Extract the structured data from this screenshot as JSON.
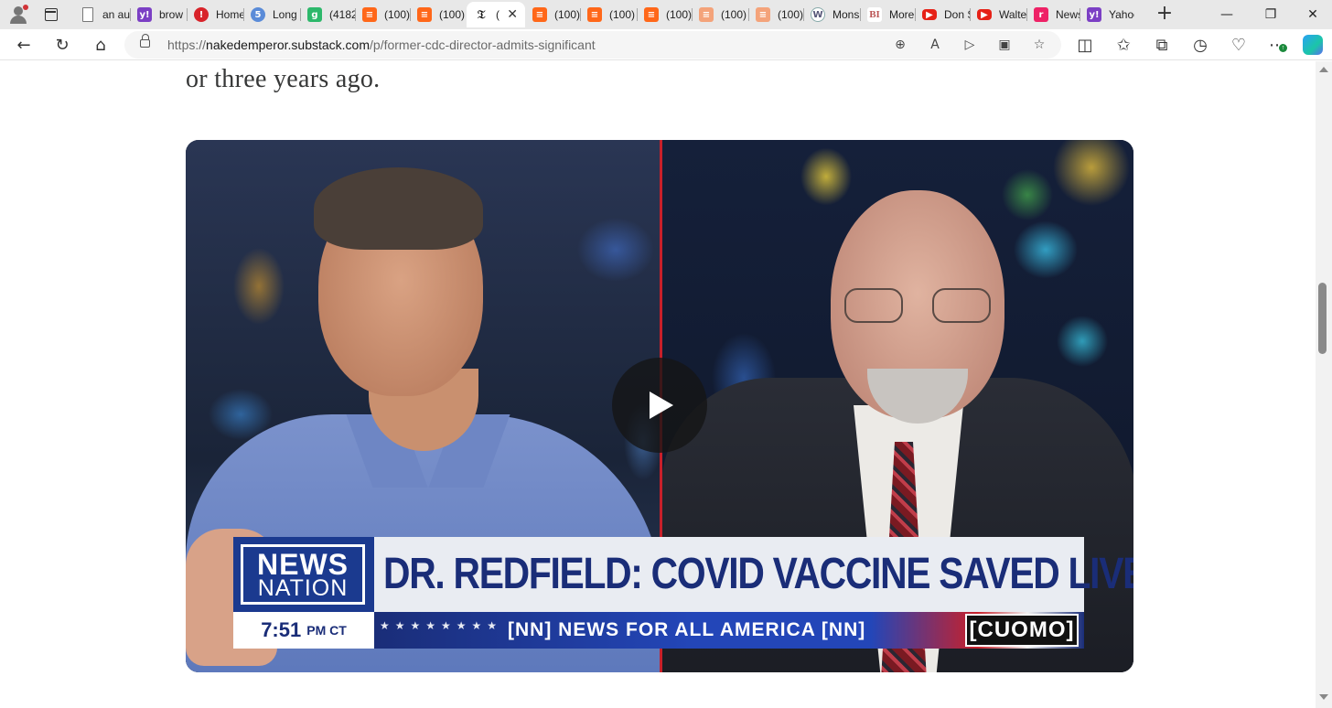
{
  "browser": {
    "tabs": [
      {
        "label": "an au",
        "favicon": "document-icon",
        "fav_glyph": "",
        "fav_class": "doc",
        "width": 62
      },
      {
        "label": "brow",
        "favicon": "yahoo-icon",
        "fav_glyph": "y!",
        "fav_class": "yahoo",
        "width": 62
      },
      {
        "label": "Home",
        "favicon": "red-pin-icon",
        "fav_glyph": "!",
        "fav_class": "red",
        "width": 62
      },
      {
        "label": "Long",
        "favicon": "five-icon",
        "fav_glyph": "5",
        "fav_class": "blue5",
        "width": 62
      },
      {
        "label": "(4182",
        "favicon": "g-icon",
        "fav_glyph": "g",
        "fav_class": "green",
        "width": 60
      },
      {
        "label": "(100)",
        "favicon": "substack-icon",
        "fav_glyph": "≡",
        "fav_class": "substack",
        "width": 60
      },
      {
        "label": "(100)",
        "favicon": "substack-icon",
        "fav_glyph": "≡",
        "fav_class": "substack",
        "width": 62
      },
      {
        "label": "(",
        "favicon": "nyt-icon",
        "fav_glyph": "𝔗",
        "fav_class": "nyt",
        "width": 64,
        "active": true
      },
      {
        "label": "(100)",
        "favicon": "substack-icon",
        "fav_glyph": "≡",
        "fav_class": "substack",
        "width": 60
      },
      {
        "label": "(100)",
        "favicon": "substack-icon",
        "fav_glyph": "≡",
        "fav_class": "substack",
        "width": 62
      },
      {
        "label": "(100)",
        "favicon": "substack-icon",
        "fav_glyph": "≡",
        "fav_class": "substack",
        "width": 60
      },
      {
        "label": "(100)",
        "favicon": "substack-icon",
        "fav_glyph": "≡",
        "fav_class": "substack-light",
        "width": 62
      },
      {
        "label": "(100)",
        "favicon": "substack-icon",
        "fav_glyph": "≡",
        "fav_class": "substack-light",
        "width": 60
      },
      {
        "label": "Mons",
        "favicon": "wordpress-icon",
        "fav_glyph": "W",
        "fav_class": "wp",
        "width": 62
      },
      {
        "label": "More",
        "favicon": "bi-icon",
        "fav_glyph": "BI",
        "fav_class": "bi",
        "width": 60
      },
      {
        "label": "Don S",
        "favicon": "youtube-icon",
        "fav_glyph": "▶",
        "fav_class": "yt",
        "width": 60
      },
      {
        "label": "Walte",
        "favicon": "youtube-icon",
        "fav_glyph": "▶",
        "fav_class": "yt",
        "width": 62
      },
      {
        "label": "News",
        "favicon": "news-icon",
        "fav_glyph": "r",
        "fav_class": "news",
        "width": 58
      },
      {
        "label": "Yahoo",
        "favicon": "yahoo-icon",
        "fav_glyph": "y!",
        "fav_class": "yahoo",
        "width": 60
      }
    ],
    "url": {
      "scheme": "https://",
      "host": "nakedemperor.substack.com",
      "path": "/p/former-cdc-director-admits-significant"
    }
  },
  "article": {
    "text_fragment": "or three years ago."
  },
  "video": {
    "lower_third": {
      "logo_line1": "NEWS",
      "logo_line2": "NATION",
      "headline": "DR. REDFIELD: COVID VACCINE SAVED LIVES",
      "time": "7:51",
      "timezone": "PM CT",
      "ticker": "[NN] NEWS FOR ALL AMERICA [NN]",
      "show_name": "[CUOMO]"
    }
  },
  "colors": {
    "network_blue": "#1a2d78",
    "divider_red": "#c8202a",
    "tab_strip": "#e8e8e8"
  }
}
